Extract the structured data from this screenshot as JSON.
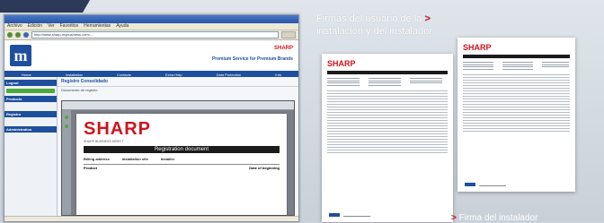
{
  "caption_top": {
    "line1": "Firmas del usuario de la",
    "arrow": ">",
    "line2": "instalación y del instalador"
  },
  "caption_bottom": {
    "arrow": ">",
    "text": "Firma del instalador"
  },
  "browser": {
    "menu": [
      "Archivo",
      "Edición",
      "Ver",
      "Favoritos",
      "Herramientas",
      "Ayuda"
    ],
    "address": "http://www.sharp-mybusiness.com/...",
    "header_brand": "SHARP",
    "header_tagline": "Premium Service for Premium Brands",
    "nav": [
      "Home",
      "Installation",
      "Contacts",
      "Extra Help",
      "Data Protection",
      "Info"
    ],
    "sidebar": {
      "sec1": "Logout",
      "sec2": "Products",
      "sec3": "Registro",
      "sec4": "Administration"
    },
    "main_title": "Registro Consolidado",
    "main_line": "Documento de registro",
    "document": {
      "brand": "SHARP",
      "tagline": "SHARP BUSINESS DIRECT",
      "title": "Registration document",
      "col1_head": "Billing address",
      "col2_head": "Installation site",
      "col3_head": "Installer",
      "table_head_left": "Product",
      "table_head_right": "Date of beginning"
    }
  },
  "colors": {
    "brand_red": "#d0141c",
    "brand_blue": "#1e4f9c"
  }
}
